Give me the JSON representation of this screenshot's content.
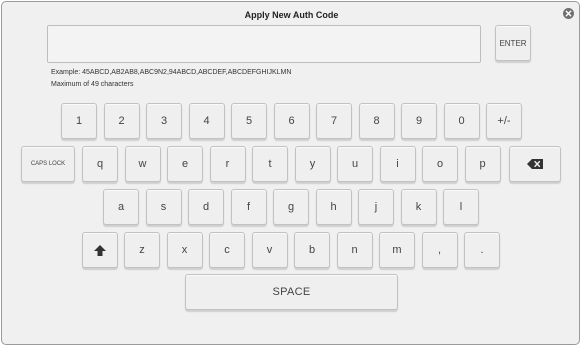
{
  "dialog": {
    "title": "Apply New Auth Code",
    "close_icon": "close-icon",
    "input": {
      "value": "",
      "placeholder": ""
    },
    "enter_label": "ENTER",
    "example_text": "Example: 45ABCD,AB2AB8,ABC9N2,94ABCD,ABCDEF,ABCDEFGHIJKLMN",
    "max_text": "Maximum of 49 characters"
  },
  "keyboard": {
    "row1": [
      "1",
      "2",
      "3",
      "4",
      "5",
      "6",
      "7",
      "8",
      "9",
      "0",
      "+/-"
    ],
    "caps_lock_label": "CAPS LOCK",
    "row2": [
      "q",
      "w",
      "e",
      "r",
      "t",
      "y",
      "u",
      "i",
      "o",
      "p"
    ],
    "backspace_icon": "backspace-icon",
    "row3": [
      "a",
      "s",
      "d",
      "f",
      "g",
      "h",
      "j",
      "k",
      "l"
    ],
    "shift_icon": "shift-arrow-icon",
    "row4": [
      "z",
      "x",
      "c",
      "v",
      "b",
      "n",
      "m",
      ",",
      "."
    ],
    "space_label": "SPACE"
  }
}
